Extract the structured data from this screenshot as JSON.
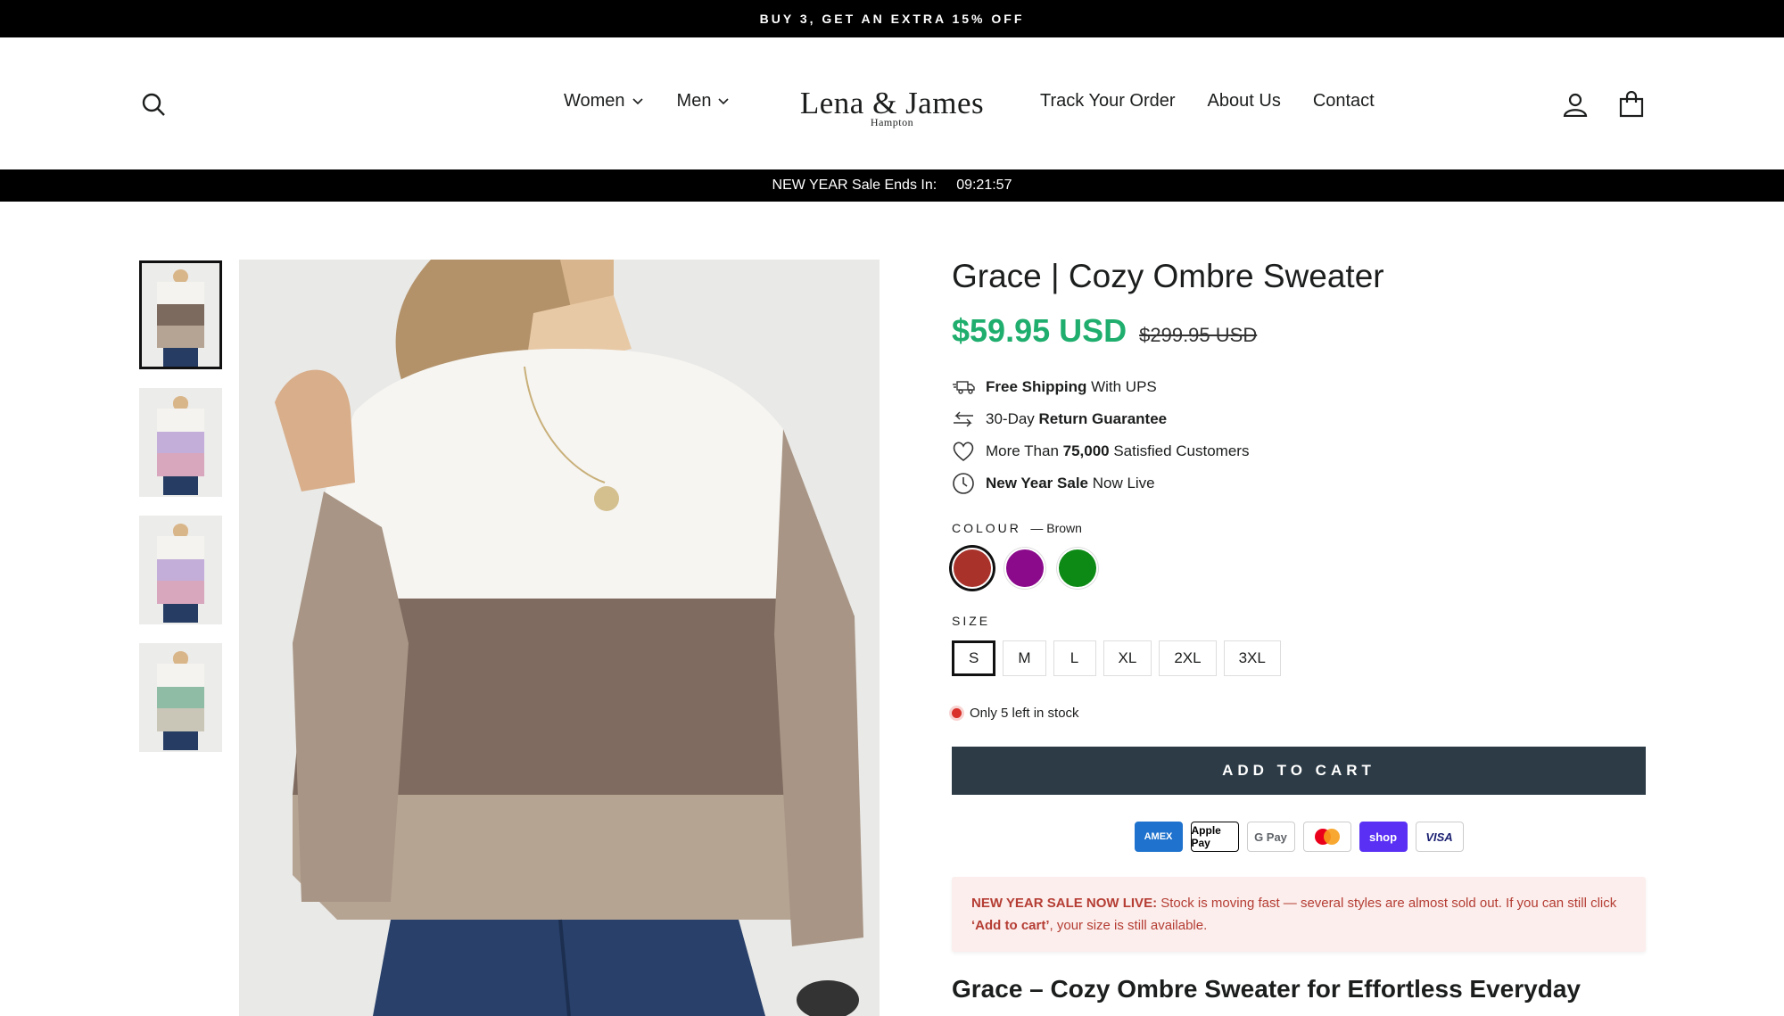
{
  "announcement": "BUY 3, GET AN EXTRA 15% OFF",
  "header": {
    "nav_left": [
      {
        "label": "Women"
      },
      {
        "label": "Men"
      }
    ],
    "logo_main": "Lena & James",
    "logo_sub": "Hampton",
    "nav_right": [
      {
        "label": "Track Your Order"
      },
      {
        "label": "About Us"
      },
      {
        "label": "Contact"
      }
    ],
    "icons": [
      "search-icon",
      "account-icon",
      "cart-icon",
      "chevron-down-icon"
    ]
  },
  "sale_bar": {
    "label": "NEW YEAR Sale Ends In:",
    "countdown": "09:21:57"
  },
  "product": {
    "title": "Grace | Cozy Ombre Sweater",
    "price": "$59.95 USD",
    "compare_price": "$299.95 USD",
    "perks": [
      {
        "icon": "truck-icon",
        "bold": "Free Shipping",
        "pre": "",
        "post": " With UPS"
      },
      {
        "icon": "return-icon",
        "bold": "Return Guarantee",
        "pre": "30-Day ",
        "post": ""
      },
      {
        "icon": "heart-icon",
        "bold": "75,000",
        "pre": "More Than ",
        "post": " Satisfied Customers"
      },
      {
        "icon": "clock-icon",
        "bold": "New Year Sale",
        "pre": "",
        "post": " Now Live"
      }
    ],
    "colour_label": "COLOUR",
    "colour_selected": "— Brown",
    "swatches": [
      {
        "name": "brown",
        "color": "#a9322b"
      },
      {
        "name": "purple",
        "color": "#8b0a8c"
      },
      {
        "name": "green",
        "color": "#0c8a15"
      }
    ],
    "size_label": "SIZE",
    "sizes": [
      "S",
      "M",
      "L",
      "XL",
      "2XL",
      "3XL"
    ],
    "selected_size": "S",
    "stock_text": "Only 5 left in stock",
    "add_to_cart": "ADD TO CART",
    "payment_methods": [
      "AMEX",
      "Apple Pay",
      "G Pay",
      "Mastercard",
      "shop",
      "VISA"
    ],
    "notice": {
      "lead": "NEW YEAR SALE NOW LIVE:",
      "text1": " Stock is moving fast — several styles are almost sold out. If you can still click ",
      "emph": "‘Add to cart’",
      "text2": ", your size is still available."
    },
    "description_title": "Grace – Cozy Ombre Sweater for Effortless Everyday"
  },
  "colors": {
    "price_green": "#1fae6d",
    "button_dark": "#2c3b46",
    "notice_bg": "#fbeeec",
    "notice_text": "#b53d34",
    "stock_dot": "#d9312b"
  }
}
